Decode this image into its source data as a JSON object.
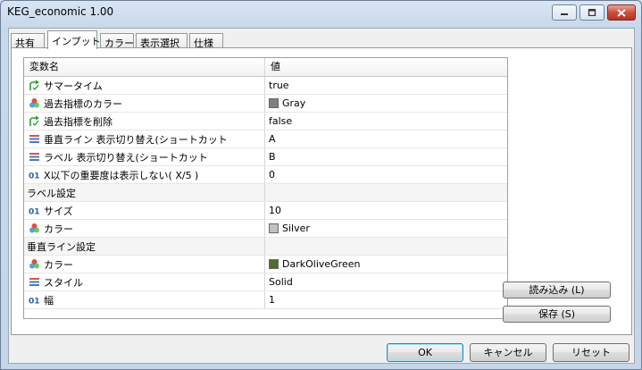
{
  "window": {
    "title": "KEG_economic 1.00"
  },
  "tabs": [
    {
      "label": "共有"
    },
    {
      "label": "インプット"
    },
    {
      "label": "カラー"
    },
    {
      "label": "表示選択"
    },
    {
      "label": "仕様"
    }
  ],
  "grid": {
    "headers": {
      "name": "変数名",
      "value": "値"
    },
    "rows": [
      {
        "icon": "bool-arrow-icon",
        "name": "サマータイム",
        "value": "true"
      },
      {
        "icon": "color-circles-icon",
        "name": "過去指標のカラー",
        "value": "Gray",
        "swatch": "#808080"
      },
      {
        "icon": "bool-arrow-icon",
        "name": "過去指標を削除",
        "value": "false"
      },
      {
        "icon": "list-lines-icon",
        "name": "垂直ライン 表示切り替え(ショートカット",
        "value": "A"
      },
      {
        "icon": "list-lines-icon",
        "name": "ラベル 表示切り替え(ショートカット",
        "value": "B"
      },
      {
        "icon": "int-01-icon",
        "name": "X以下の重要度は表示しない( X/5 )",
        "value": "0"
      },
      {
        "section": true,
        "name": "ラベル設定",
        "value": ""
      },
      {
        "icon": "int-01-icon",
        "name": "サイズ",
        "value": "10"
      },
      {
        "icon": "color-circles-icon",
        "name": "カラー",
        "value": "Silver",
        "swatch": "#c0c0c0"
      },
      {
        "section": true,
        "name": "垂直ライン設定",
        "value": ""
      },
      {
        "icon": "color-circles-icon",
        "name": "カラー",
        "value": "DarkOliveGreen",
        "swatch": "#556b2f"
      },
      {
        "icon": "list-lines-icon",
        "name": "スタイル",
        "value": "Solid"
      },
      {
        "icon": "int-01-icon",
        "name": "幅",
        "value": "1"
      }
    ]
  },
  "side_buttons": {
    "load": "読み込み (L)",
    "save": "保存 (S)"
  },
  "bottom_buttons": {
    "ok": "OK",
    "cancel": "キャンセル",
    "reset": "リセット"
  }
}
